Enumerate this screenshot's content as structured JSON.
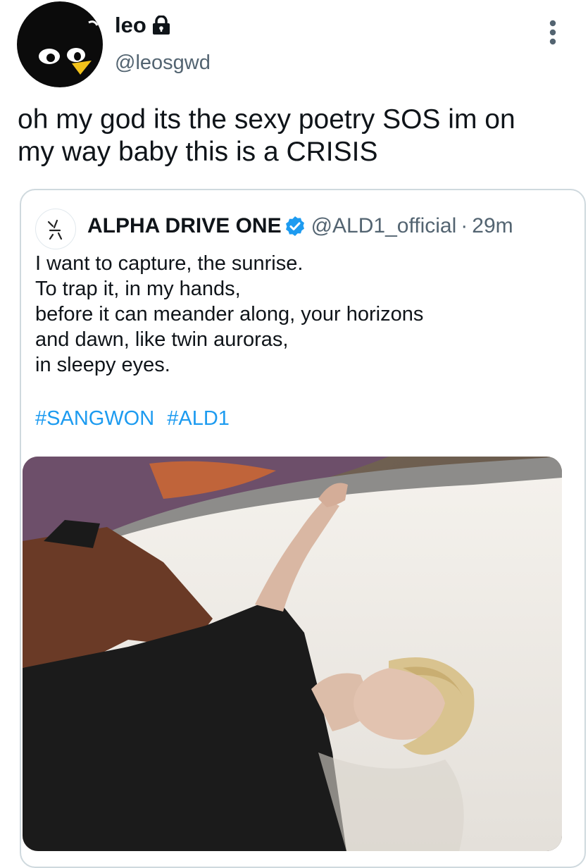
{
  "tweet": {
    "display_name": "leo",
    "handle": "@leosgwd",
    "text": "oh my god its the sexy poetry SOS im on\nmy way baby this is a CRISIS",
    "icons": {
      "lock": "lock-icon",
      "more": "more-vertical-icon"
    }
  },
  "quoted_tweet": {
    "display_name": "ALPHA DRIVE ONE",
    "handle": "@ALD1_official",
    "separator": "·",
    "time": "29m",
    "lines": [
      "I want to capture, the sunrise.",
      "To trap it, in my hands,",
      "before it can meander along, your horizons",
      "and dawn, like twin auroras,",
      "in sleepy eyes."
    ],
    "hashtags": [
      "#SANGWON",
      "#ALD1"
    ],
    "icons": {
      "verified": "verified-badge-icon"
    }
  },
  "colors": {
    "text_primary": "#0f1419",
    "text_secondary": "#536471",
    "link": "#1d9bf0",
    "border": "#cfd9de",
    "verified": "#1d9bf0"
  }
}
